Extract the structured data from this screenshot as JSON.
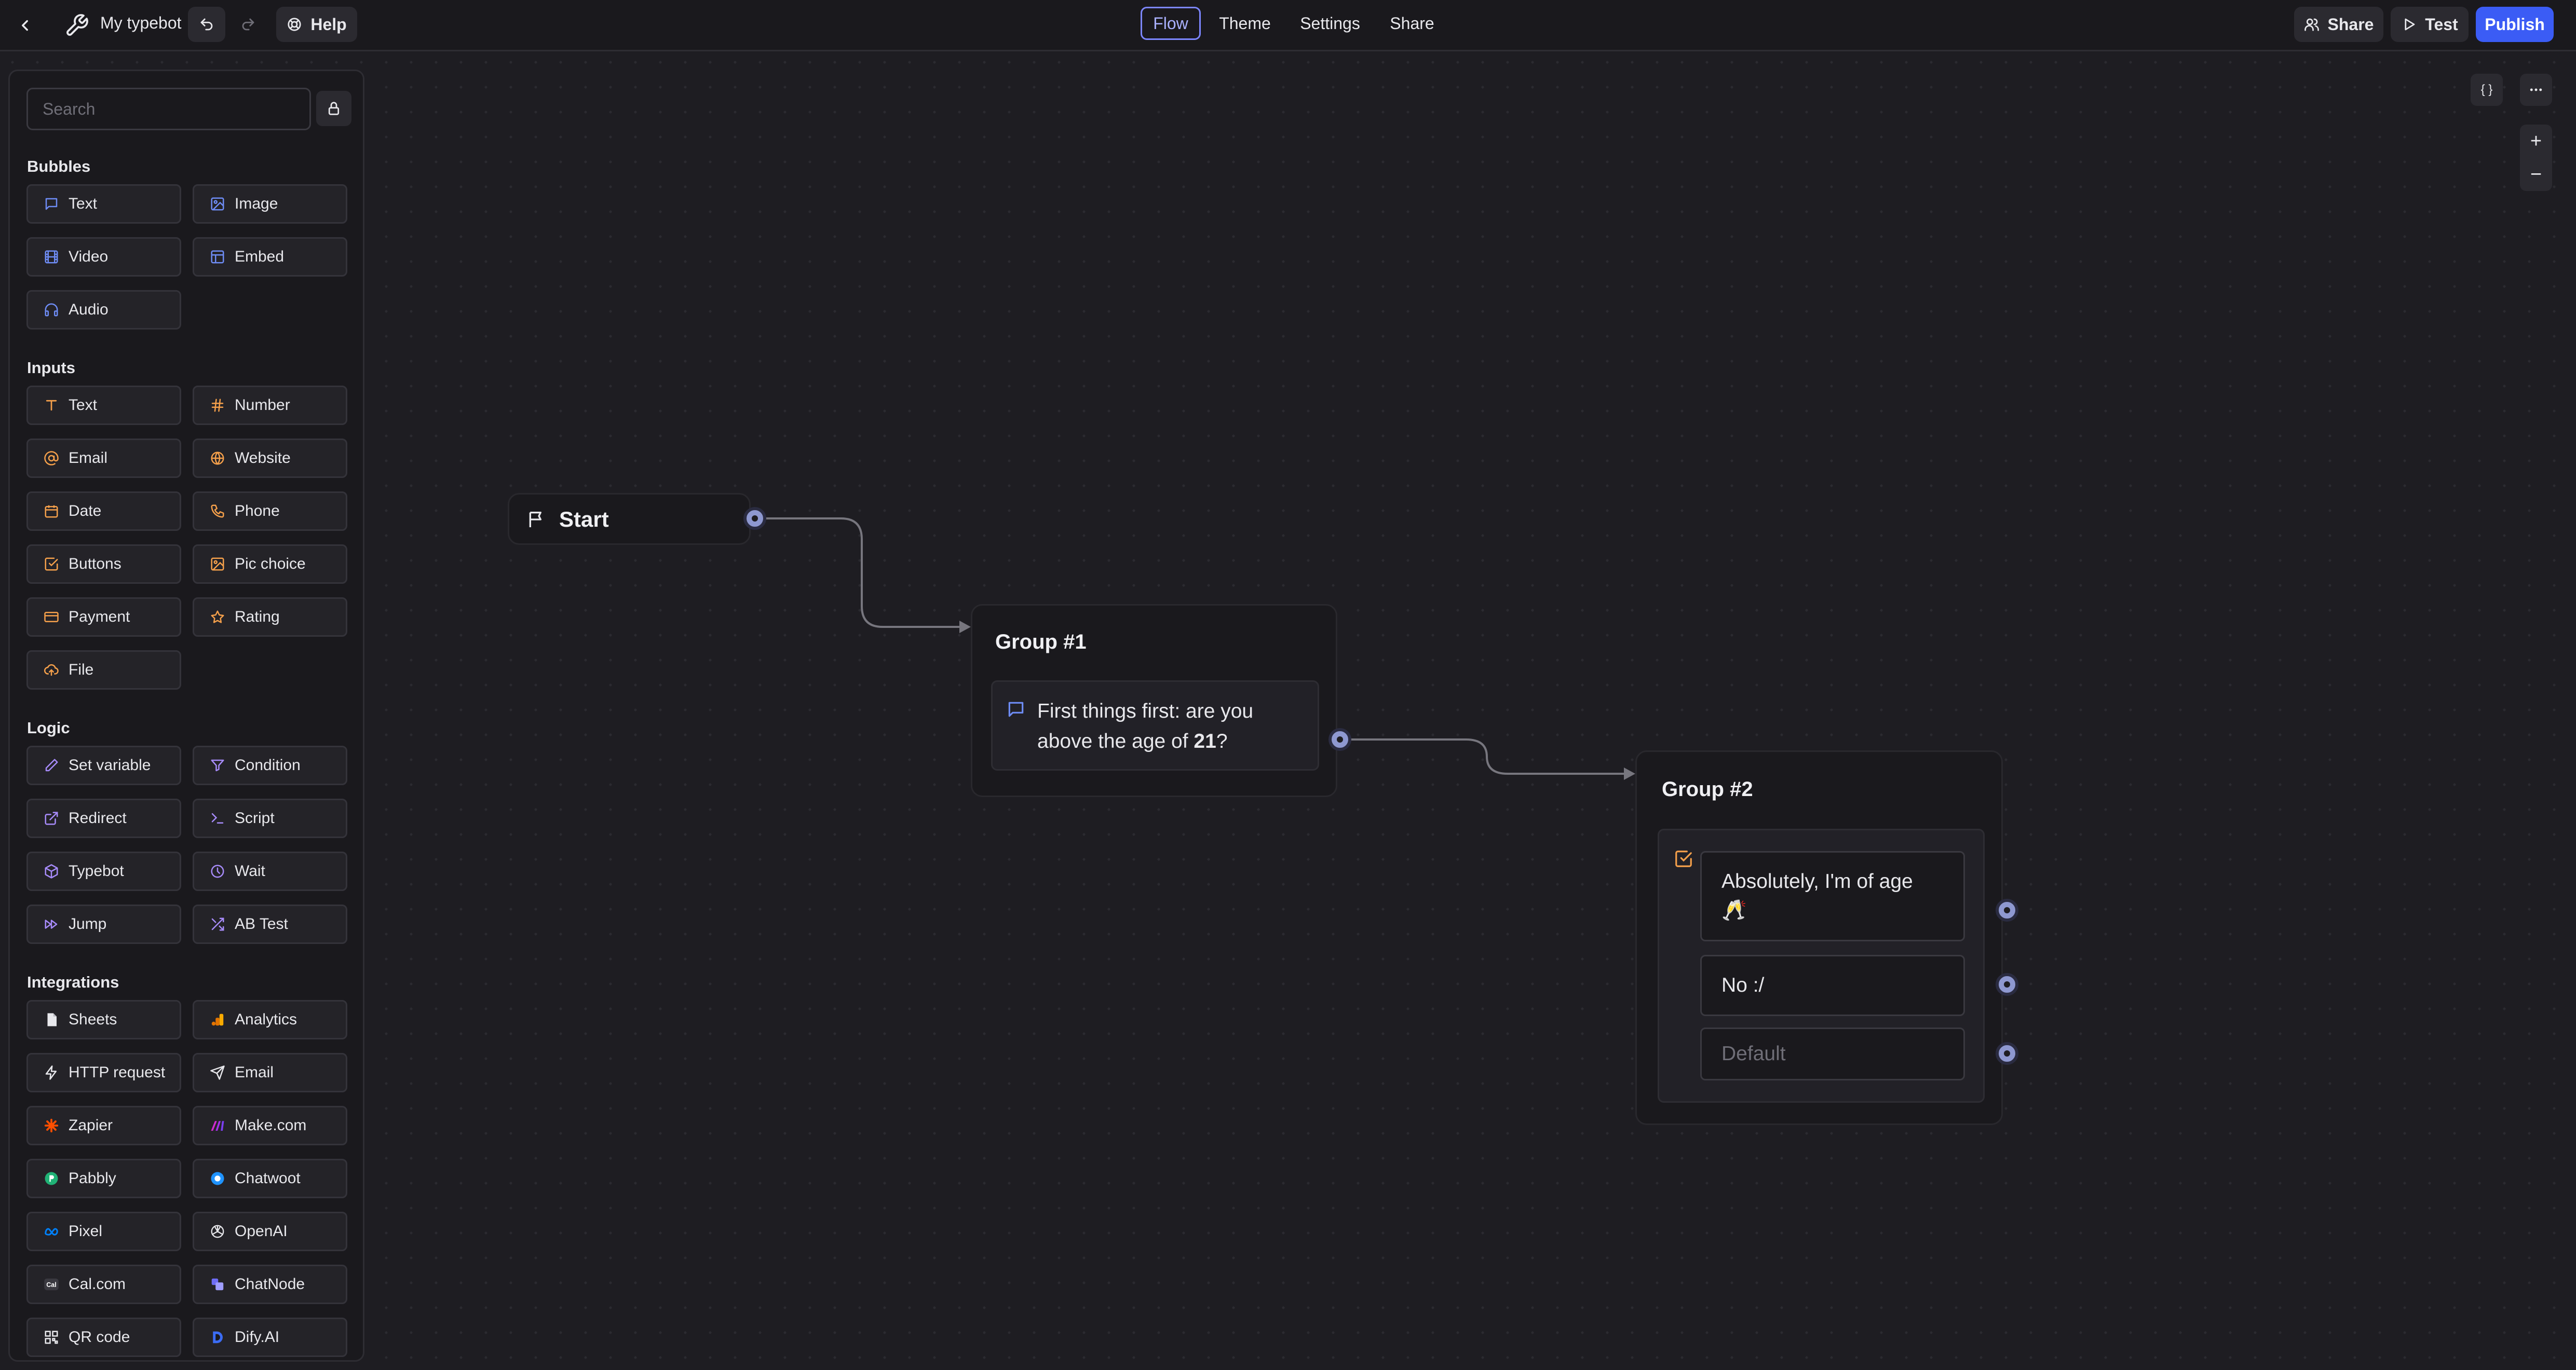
{
  "header": {
    "project_name": "My typebot",
    "help_label": "Help",
    "tabs": [
      {
        "label": "Flow",
        "active": true
      },
      {
        "label": "Theme",
        "active": false
      },
      {
        "label": "Settings",
        "active": false
      },
      {
        "label": "Share",
        "active": false
      }
    ],
    "share_label": "Share",
    "test_label": "Test",
    "publish_label": "Publish"
  },
  "colors": {
    "accent": "#3b5cf5",
    "active_tab": "#7c86ff",
    "bubble_icon": "#6e8cf5",
    "input_icon": "#f5a04b",
    "logic_icon": "#a78bfa"
  },
  "sidebar": {
    "search_placeholder": "Search",
    "sections": {
      "bubbles": {
        "title": "Bubbles",
        "items": [
          {
            "label": "Text",
            "icon": "message-icon"
          },
          {
            "label": "Image",
            "icon": "image-icon"
          },
          {
            "label": "Video",
            "icon": "film-icon"
          },
          {
            "label": "Embed",
            "icon": "layout-icon"
          },
          {
            "label": "Audio",
            "icon": "headphones-icon"
          }
        ]
      },
      "inputs": {
        "title": "Inputs",
        "items": [
          {
            "label": "Text",
            "icon": "text-cursor-icon"
          },
          {
            "label": "Number",
            "icon": "hash-icon"
          },
          {
            "label": "Email",
            "icon": "at-sign-icon"
          },
          {
            "label": "Website",
            "icon": "globe-icon"
          },
          {
            "label": "Date",
            "icon": "calendar-icon"
          },
          {
            "label": "Phone",
            "icon": "phone-icon"
          },
          {
            "label": "Buttons",
            "icon": "checkbox-icon"
          },
          {
            "label": "Pic choice",
            "icon": "image-icon"
          },
          {
            "label": "Payment",
            "icon": "credit-card-icon"
          },
          {
            "label": "Rating",
            "icon": "star-icon"
          },
          {
            "label": "File",
            "icon": "upload-cloud-icon"
          }
        ]
      },
      "logic": {
        "title": "Logic",
        "items": [
          {
            "label": "Set variable",
            "icon": "pencil-icon"
          },
          {
            "label": "Condition",
            "icon": "filter-icon"
          },
          {
            "label": "Redirect",
            "icon": "external-link-icon"
          },
          {
            "label": "Script",
            "icon": "terminal-icon"
          },
          {
            "label": "Typebot",
            "icon": "cube-icon"
          },
          {
            "label": "Wait",
            "icon": "clock-icon"
          },
          {
            "label": "Jump",
            "icon": "fast-forward-icon"
          },
          {
            "label": "AB Test",
            "icon": "shuffle-icon"
          }
        ]
      },
      "integrations": {
        "title": "Integrations",
        "items": [
          {
            "label": "Sheets",
            "icon": "sheets-icon"
          },
          {
            "label": "Analytics",
            "icon": "analytics-icon"
          },
          {
            "label": "HTTP request",
            "icon": "bolt-icon"
          },
          {
            "label": "Email",
            "icon": "send-icon"
          },
          {
            "label": "Zapier",
            "icon": "zapier-icon"
          },
          {
            "label": "Make.com",
            "icon": "make-icon"
          },
          {
            "label": "Pabbly",
            "icon": "pabbly-icon"
          },
          {
            "label": "Chatwoot",
            "icon": "chatwoot-icon"
          },
          {
            "label": "Pixel",
            "icon": "meta-icon"
          },
          {
            "label": "OpenAI",
            "icon": "openai-icon"
          },
          {
            "label": "Cal.com",
            "icon": "calcom-icon"
          },
          {
            "label": "ChatNode",
            "icon": "chatnode-icon"
          },
          {
            "label": "QR code",
            "icon": "qr-code-icon"
          },
          {
            "label": "Dify.AI",
            "icon": "dify-icon"
          }
        ]
      }
    }
  },
  "canvas": {
    "start": {
      "label": "Start"
    },
    "group1": {
      "title": "Group #1",
      "message_line1": "First things first: are you",
      "message_line2": "above the age of ",
      "message_bold": "21",
      "message_end": "?"
    },
    "group2": {
      "title": "Group #2",
      "choices": [
        "Absolutely, I'm of age",
        "🥂",
        "No :/"
      ],
      "default_label": "Default"
    },
    "controls": {
      "variables_label": "{ }",
      "zoom_in": "+",
      "zoom_out": "−"
    }
  }
}
